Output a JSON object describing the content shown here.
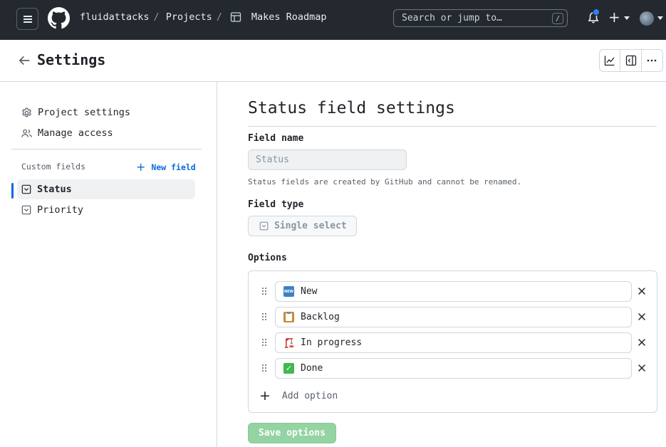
{
  "header": {
    "breadcrumbs": [
      "fluidattacks",
      "Projects",
      "Makes Roadmap"
    ],
    "search_placeholder": "Search or jump to…",
    "search_shortcut": "/",
    "icons": [
      "hamburger-icon",
      "github-logo-icon",
      "table-icon",
      "bell-icon",
      "plus-icon",
      "chevron-down-icon",
      "avatar"
    ],
    "notification_dot_color": "#2f81f7"
  },
  "settings": {
    "title": "Settings",
    "toolbar_icons": [
      "graph-icon",
      "sidebar-expand-icon",
      "kebab-horizontal-icon"
    ]
  },
  "sidebar": {
    "items": [
      {
        "label": "Project settings",
        "icon": "gear-icon"
      },
      {
        "label": "Manage access",
        "icon": "people-icon"
      }
    ],
    "custom_fields_label": "Custom fields",
    "new_field_label": "New field",
    "fields": [
      {
        "label": "Status",
        "icon": "single-select-icon",
        "active": true
      },
      {
        "label": "Priority",
        "icon": "single-select-icon",
        "active": false
      }
    ],
    "accent_color": "#0969da"
  },
  "main": {
    "title": "Status field settings",
    "field_name_label": "Field name",
    "field_name_value": "Status",
    "field_name_help": "Status fields are created by GitHub and cannot be renamed.",
    "field_type_label": "Field type",
    "field_type_value": "Single select",
    "options_label": "Options",
    "options": [
      {
        "label": "New",
        "emoji": "new-emoji-icon"
      },
      {
        "label": "Backlog",
        "emoji": "clipboard-emoji-icon"
      },
      {
        "label": "In progress",
        "emoji": "construction-crane-emoji-icon"
      },
      {
        "label": "Done",
        "emoji": "check-mark-button-emoji-icon"
      }
    ],
    "add_option_label": "Add option",
    "save_label": "Save options",
    "save_color": "#94d3a2"
  }
}
